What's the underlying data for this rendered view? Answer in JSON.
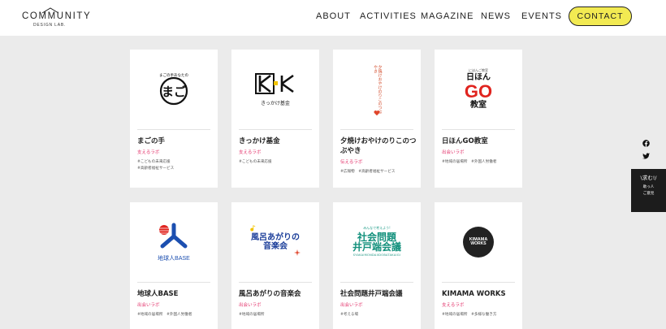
{
  "header": {
    "logo_main": "COMMUNITY",
    "logo_sub": "DESIGN LAB.",
    "nav": [
      "ABOUT",
      "ACTIVITIES",
      "MAGAZINE",
      "NEWS",
      "EVENTS"
    ],
    "contact": "CONTACT",
    "contact_color": "#f2ea52"
  },
  "cards": [
    {
      "title": "まごの手",
      "category": "支えるラボ",
      "tags": [
        "#こどもの未来応援",
        "#高齢者福祉サービス"
      ],
      "logo_text": "まごの手",
      "logo_arc": "まごの手あなたの"
    },
    {
      "title": "きっかけ基金",
      "category": "支えるラボ",
      "tags": [
        "#こどもの未来応援"
      ],
      "logo_text": "きっかけ基金",
      "logo_mark": "K·K"
    },
    {
      "title": "夕焼けおやけのりこのつぶやき",
      "category": "伝えるラボ",
      "tags": [
        "#広報物　#高齢者福祉サービス"
      ],
      "logo_text": "夕焼けおやけのりこのつぶやき"
    },
    {
      "title": "日ほんGO教室",
      "category": "出会いラボ",
      "tags": [
        "#地域の居場所　#外国人労働者"
      ],
      "logo_top": "日ほん",
      "logo_small": "にほんご教室",
      "logo_go": "GO",
      "logo_bottom": "教室"
    },
    {
      "title": "地球人BASE",
      "category": "出会いラボ",
      "tags": [
        "#地域の居場所　#外国人労働者"
      ],
      "logo_text": "地球人BASE"
    },
    {
      "title": "風呂あがりの音楽会",
      "category": "出会いラボ",
      "tags": [
        "#地域の居場所"
      ],
      "logo_text": "風呂あがりの音楽会"
    },
    {
      "title": "社会問題井戸端会議",
      "category": "出会いラボ",
      "tags": [
        "#考える場"
      ],
      "logo_small": "みんなで考えよう!",
      "logo_l1": "社会問題",
      "logo_l2": "井戸端会議",
      "logo_url": "SYAKAIMONDAIIDOBATAKAIGI"
    },
    {
      "title": "KIMAMA WORKS",
      "category": "支えるラボ",
      "tags": [
        "#地域の居場所　#多様な働き方"
      ],
      "logo_l1": "KIMAMA",
      "logo_l2": "WORKS"
    }
  ],
  "social": {
    "facebook": "facebook-icon",
    "twitter": "twitter-icon"
  },
  "float_box": {
    "line1": "\\求む!/",
    "line2": "助っ人",
    "line3": "ご意見"
  }
}
